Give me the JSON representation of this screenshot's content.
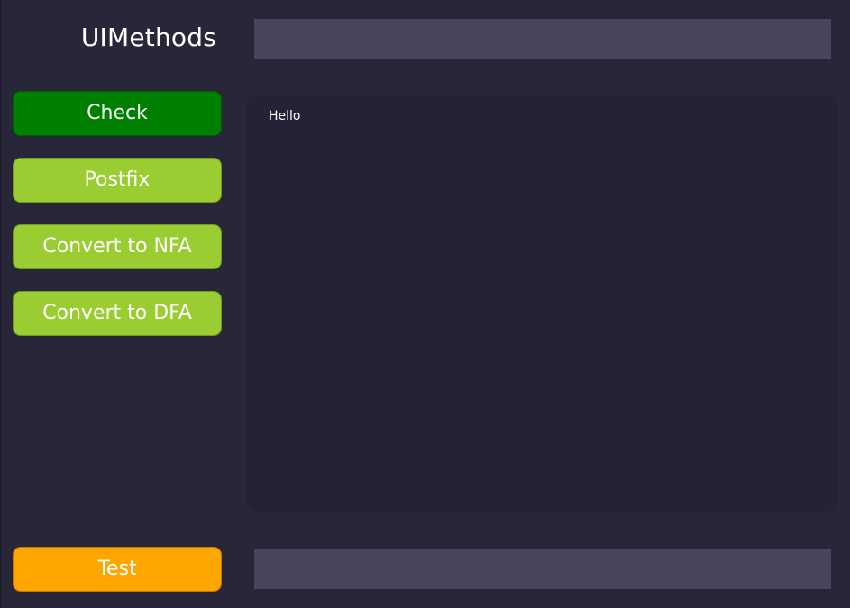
{
  "app": {
    "title": "UIMethods"
  },
  "inputs": {
    "expression_value": "",
    "test_value": ""
  },
  "buttons": {
    "check_label": "Check",
    "postfix_label": "Postfix",
    "nfa_label": "Convert to NFA",
    "dfa_label": "Convert to DFA",
    "test_label": "Test"
  },
  "output": {
    "text": "Hello"
  },
  "colors": {
    "background": "#282639",
    "input_background": "#47455b",
    "panel_background": "#242234",
    "check_button": "#008000",
    "action_button": "#9acd32",
    "test_button": "#ffa500",
    "text": "#ffffff"
  }
}
